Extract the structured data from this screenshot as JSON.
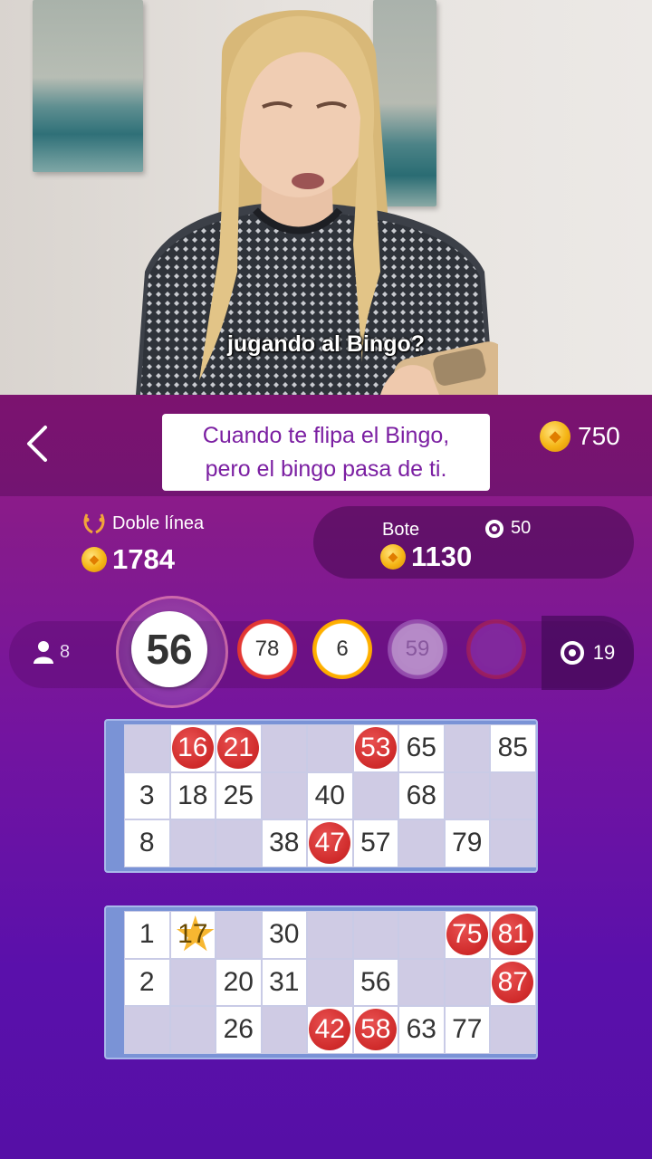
{
  "video": {
    "caption": "jugando al Bingo?"
  },
  "header": {
    "headline_line1": "Cuando te flipa el Bingo,",
    "headline_line2": "pero el bingo pasa de ti.",
    "coins": "750"
  },
  "prize": {
    "title": "Doble línea",
    "value": "1784"
  },
  "pot": {
    "title": "Bote",
    "cost": "50",
    "value": "1130"
  },
  "draw": {
    "players": "8",
    "current_ball": "56",
    "previous_balls": [
      "78",
      "6",
      "59"
    ],
    "tickets": "19"
  },
  "cards": [
    {
      "rows": [
        [
          {
            "v": ""
          },
          {
            "v": "16",
            "m": true
          },
          {
            "v": "21",
            "m": true
          },
          {
            "v": ""
          },
          {
            "v": ""
          },
          {
            "v": "53",
            "m": true
          },
          {
            "v": "65"
          },
          {
            "v": ""
          },
          {
            "v": "85"
          }
        ],
        [
          {
            "v": "3"
          },
          {
            "v": "18"
          },
          {
            "v": "25"
          },
          {
            "v": ""
          },
          {
            "v": "40"
          },
          {
            "v": ""
          },
          {
            "v": "68"
          },
          {
            "v": ""
          },
          {
            "v": ""
          }
        ],
        [
          {
            "v": "8"
          },
          {
            "v": ""
          },
          {
            "v": ""
          },
          {
            "v": "38"
          },
          {
            "v": "47",
            "m": true
          },
          {
            "v": "57"
          },
          {
            "v": ""
          },
          {
            "v": "79"
          },
          {
            "v": ""
          }
        ]
      ]
    },
    {
      "rows": [
        [
          {
            "v": "1"
          },
          {
            "v": "17",
            "star": true
          },
          {
            "v": ""
          },
          {
            "v": "30"
          },
          {
            "v": ""
          },
          {
            "v": ""
          },
          {
            "v": ""
          },
          {
            "v": "75",
            "m": true
          },
          {
            "v": "81",
            "m": true
          }
        ],
        [
          {
            "v": "2"
          },
          {
            "v": ""
          },
          {
            "v": "20"
          },
          {
            "v": "31"
          },
          {
            "v": ""
          },
          {
            "v": "56"
          },
          {
            "v": ""
          },
          {
            "v": ""
          },
          {
            "v": "87",
            "m": true
          }
        ],
        [
          {
            "v": ""
          },
          {
            "v": ""
          },
          {
            "v": "26"
          },
          {
            "v": ""
          },
          {
            "v": "42",
            "m": true
          },
          {
            "v": "58",
            "m": true
          },
          {
            "v": "63"
          },
          {
            "v": "77"
          },
          {
            "v": ""
          }
        ]
      ]
    }
  ]
}
